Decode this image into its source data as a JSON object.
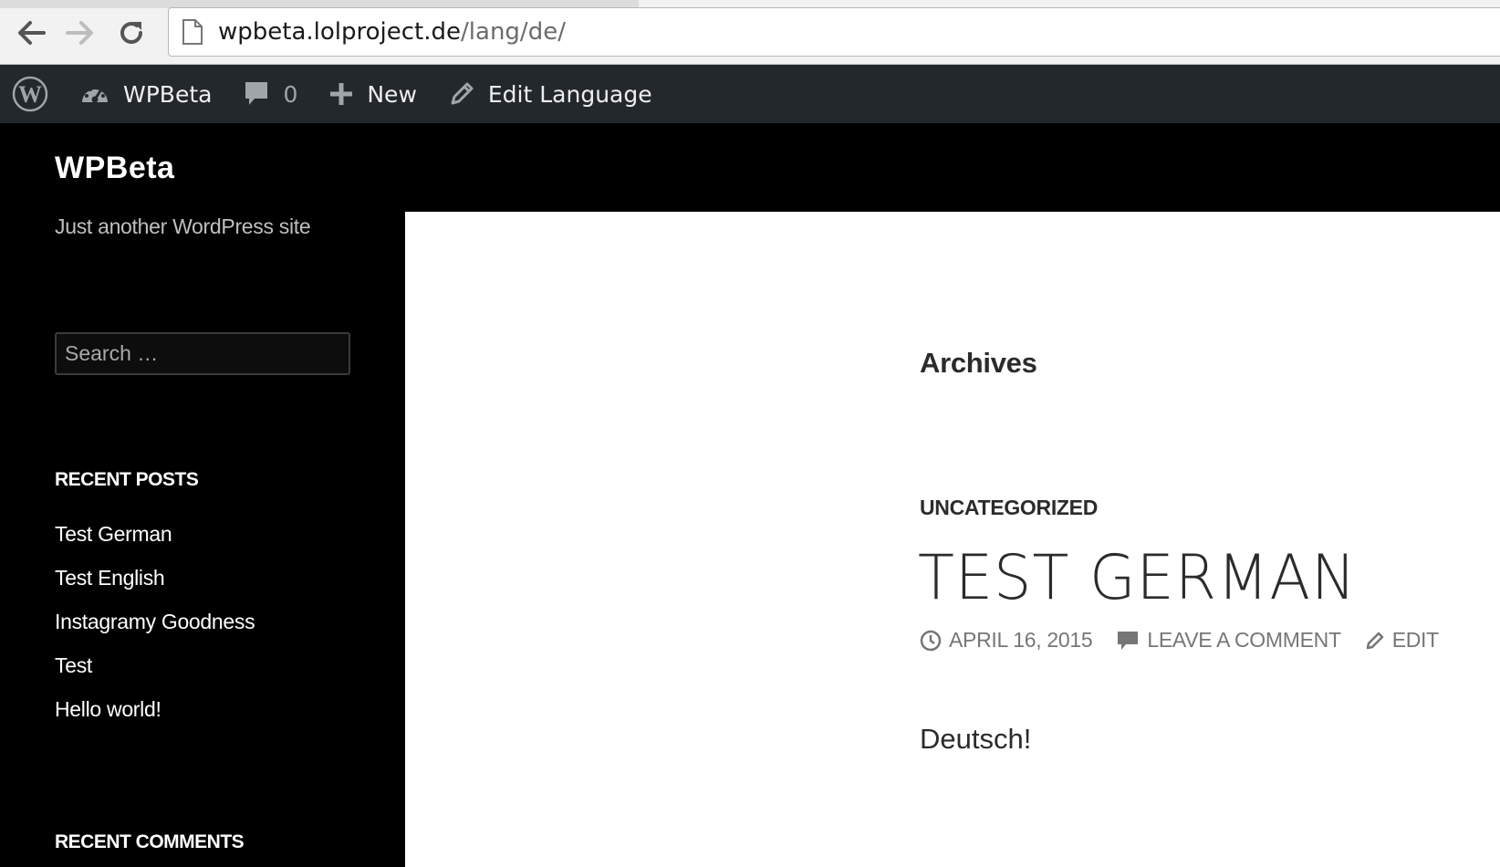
{
  "browser": {
    "url_host": "wpbeta.lolproject.de",
    "url_path": "/lang/de/"
  },
  "adminbar": {
    "site_name": "WPBeta",
    "comments_count": "0",
    "new_label": "New",
    "edit_language_label": "Edit Language"
  },
  "sidebar": {
    "site_title": "WPBeta",
    "site_description": "Just another WordPress site",
    "search_placeholder": "Search …",
    "recent_posts_title": "RECENT POSTS",
    "recent_posts": [
      "Test German",
      "Test English",
      "Instagramy Goodness",
      "Test",
      "Hello world!"
    ],
    "recent_comments_title": "RECENT COMMENTS"
  },
  "content": {
    "archives_title": "Archives",
    "category": "UNCATEGORIZED",
    "post_title": "TEST GERMAN",
    "date": "APRIL 16, 2015",
    "comment_link": "LEAVE A COMMENT",
    "edit_link": "EDIT",
    "body": "Deutsch!"
  }
}
